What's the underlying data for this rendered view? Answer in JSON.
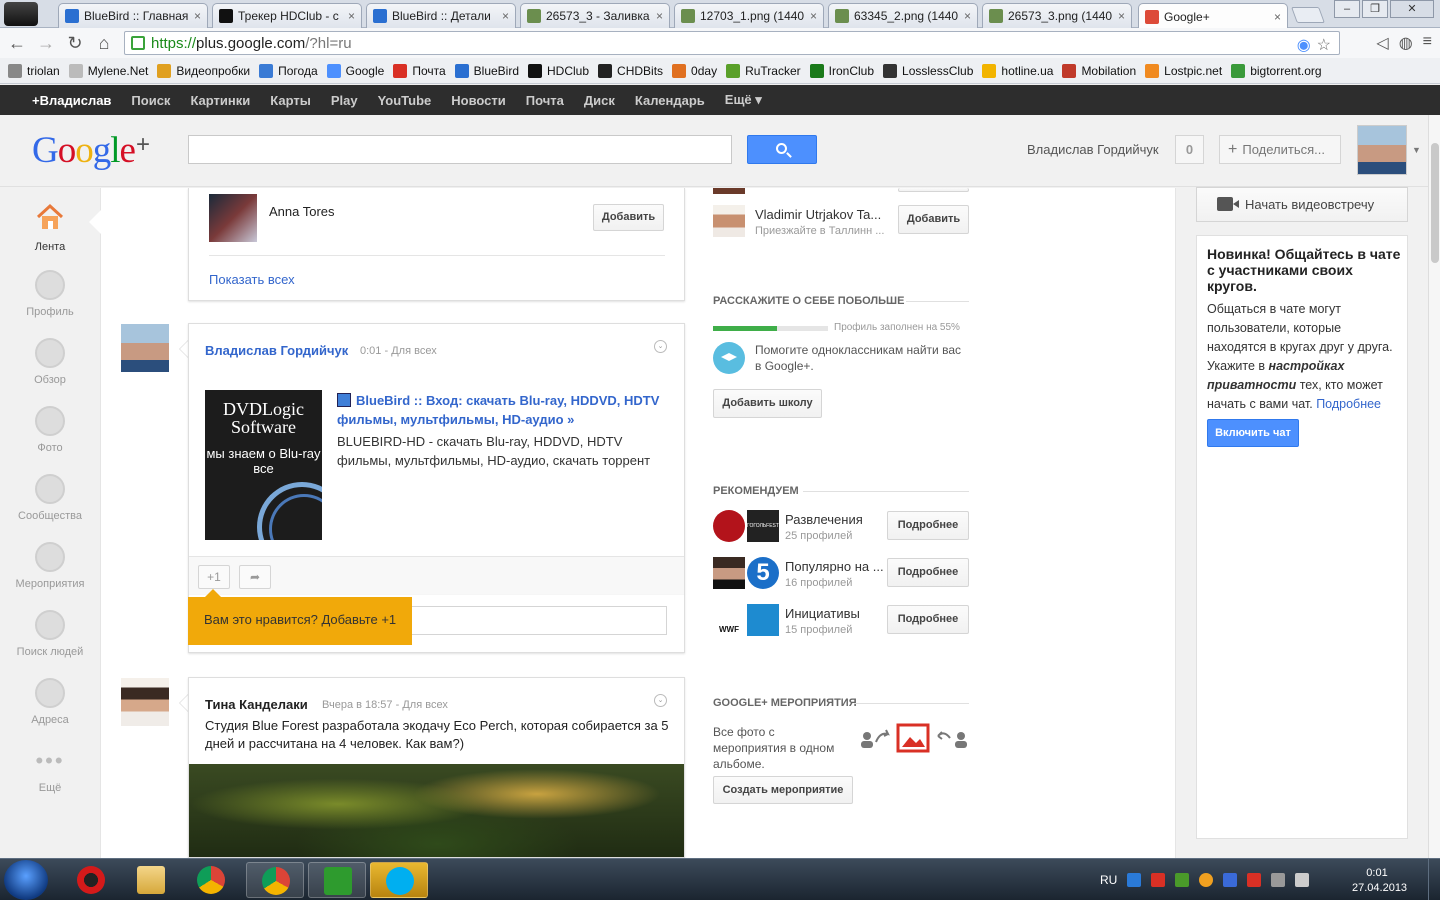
{
  "browser": {
    "tabs": [
      {
        "label": "BlueBird :: Главная",
        "favicon_color": "#2a6fd1"
      },
      {
        "label": "Трекер HDClub - с",
        "favicon_color": "#111111"
      },
      {
        "label": "BlueBird :: Детали",
        "favicon_color": "#2a6fd1"
      },
      {
        "label": "26573_3 - Заливка",
        "favicon_color": "#6b8e4e"
      },
      {
        "label": "12703_1.png (1440",
        "favicon_color": "#6b8e4e"
      },
      {
        "label": "63345_2.png (1440",
        "favicon_color": "#6b8e4e"
      },
      {
        "label": "26573_3.png (1440",
        "favicon_color": "#6b8e4e"
      },
      {
        "label": "Google+",
        "favicon_color": "#dd4b39"
      }
    ],
    "tab_close_glyph": "×",
    "url_protocol": "https://",
    "url_host": "plus.google.com",
    "url_path": "/?hl=ru",
    "bookmarks": [
      {
        "label": "triolan",
        "color": "#888888"
      },
      {
        "label": "Mylene.Net",
        "color": "#bbbbbb"
      },
      {
        "label": "Видеопробки",
        "color": "#e0a020"
      },
      {
        "label": "Погода",
        "color": "#3a7bd5"
      },
      {
        "label": "Google",
        "color": "#4d90fe"
      },
      {
        "label": "Почта",
        "color": "#d93025"
      },
      {
        "label": "BlueBird",
        "color": "#2a6fd1"
      },
      {
        "label": "HDClub",
        "color": "#111111"
      },
      {
        "label": "CHDBits",
        "color": "#222222"
      },
      {
        "label": "0day",
        "color": "#e07020"
      },
      {
        "label": "RuTracker",
        "color": "#5aa02a"
      },
      {
        "label": "IronClub",
        "color": "#1a7a1a"
      },
      {
        "label": "LosslessClub",
        "color": "#333333"
      },
      {
        "label": "hotline.ua",
        "color": "#f2b400"
      },
      {
        "label": "Mobilation",
        "color": "#c03a2a"
      },
      {
        "label": "Lostpic.net",
        "color": "#f08a20"
      },
      {
        "label": "bigtorrent.org",
        "color": "#3a9a3a"
      }
    ]
  },
  "gbar": {
    "items": [
      "+Владислав",
      "Поиск",
      "Картинки",
      "Карты",
      "Play",
      "YouTube",
      "Новости",
      "Почта",
      "Диск",
      "Календарь",
      "Ещё ▾"
    ]
  },
  "header": {
    "logo_letters": [
      "G",
      "o",
      "o",
      "g",
      "l",
      "e"
    ],
    "logo_colors": [
      "#3369e8",
      "#d50f25",
      "#eeb211",
      "#3369e8",
      "#009925",
      "#d50f25"
    ],
    "logo_plus": "+",
    "user_name": "Владислав Гордийчук",
    "notifications": "0",
    "share_plus": "+",
    "share_label": "Поделиться..."
  },
  "leftnav": {
    "items": [
      "Лента",
      "Профиль",
      "Обзор",
      "Фото",
      "Сообщества",
      "Мероприятия",
      "Поиск людей",
      "Адреса",
      "Ещё"
    ]
  },
  "suggest": {
    "person_name": "Anna Tores",
    "add_label": "Добавить",
    "show_all": "Показать всех"
  },
  "post1": {
    "author": "Владислав Гордийчук",
    "time": "0:01",
    "sep": "-",
    "audience": "Для всех",
    "menu_glyph": "⌄",
    "thumb_line1": "DVDLogic Software",
    "thumb_line2": "мы знаем о Blu-ray все",
    "link_title": "BlueBird :: Вход: скачать Blu-ray, HDDVD, HDTV фильмы, мультфильмы, HD-аудио »",
    "link_desc": "BLUEBIRD-HD - скачать Blu-ray, HDDVD, HDTV фильмы, мультфильмы, HD-аудио, скачать торрент",
    "plus_one": "+1",
    "share_glyph": "➦"
  },
  "tooltip": {
    "text": "Вам это нравится? Добавьте +1"
  },
  "post2": {
    "author": "Тина Канделаки",
    "time": "Вчера в 18:57",
    "sep": "-",
    "audience": "Для всех",
    "menu_glyph": "⌄",
    "text": "Студия Blue Forest разработала экодачу Eco Perch, которая собирается за 5 дней и рассчитана на 4 человек. Как вам?)"
  },
  "middle": {
    "suggest_name": "Vladimir Utrjakov Ta...",
    "suggest_sub": "Приезжайте в Таллинн ...",
    "add_label": "Добавить",
    "about_head": "РАССКАЖИТЕ О СЕБЕ ПОБОЛЬШЕ",
    "profile_progress": 0.55,
    "progress_label": "Профиль заполнен на 55%",
    "school_text": "Помогите одноклассникам найти вас в Google+.",
    "add_school": "Добавить школу",
    "recommend_head": "РЕКОМЕНДУЕМ",
    "recs": [
      {
        "title": "Развлечения",
        "sub": "25 профилей",
        "btn": "Подробнее"
      },
      {
        "title": "Популярно на ...",
        "sub": "16 профилей",
        "btn": "Подробнее"
      },
      {
        "title": "Инициативы",
        "sub": "15 профилей",
        "btn": "Подробнее"
      }
    ],
    "rec_badge_text": "ГОГОЛЬFEST",
    "rec_five": "5",
    "rec_wwf": "WWF",
    "events_head": "GOOGLE+ МЕРОПРИЯТИЯ",
    "events_text": "Все фото с мероприятия в одном альбоме.",
    "create_event": "Создать мероприятие"
  },
  "right": {
    "hangout_label": "Начать видеовстречу",
    "chat_title": "Новинка! Общайтесь в чате с участниками своих кругов.",
    "chat_body_1": "Общаться в чате могут пользователи, которые находятся в кругах друг у друга. Укажите в ",
    "chat_body_em": "настройках приватности",
    "chat_body_2": " тех, кто может начать с вами чат. ",
    "chat_more": "Подробнее",
    "enable_chat": "Включить чат"
  },
  "taskbar": {
    "lang": "RU",
    "time": "0:01",
    "date": "27.04.2013"
  }
}
